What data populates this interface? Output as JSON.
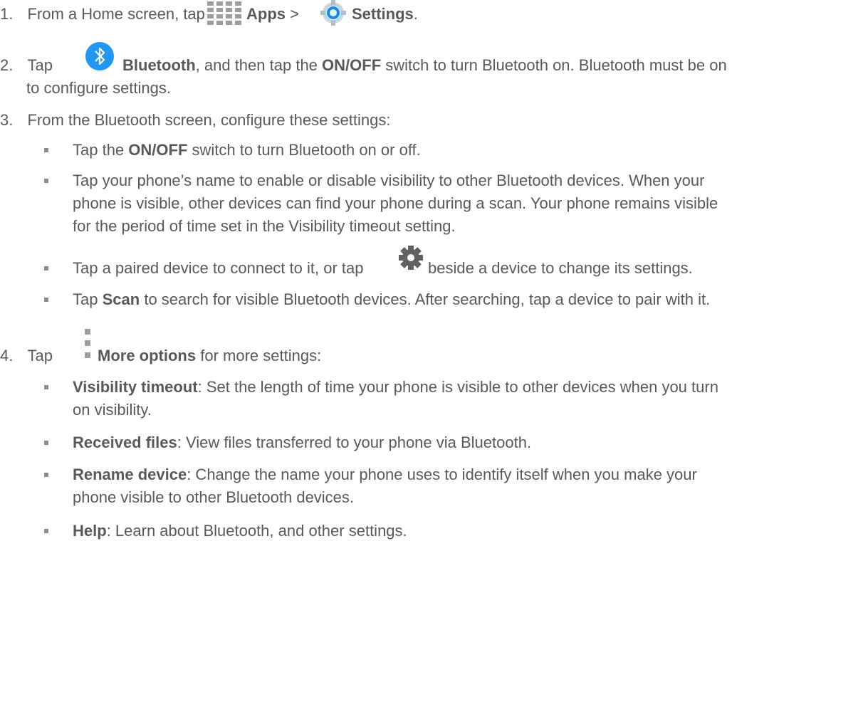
{
  "steps": [
    {
      "number": "1.",
      "parts": [
        "From a Home screen, tap",
        "Apps",
        ">",
        "Settings",
        "."
      ],
      "icons": [
        "apps-grid-icon",
        "settings-gear-icon"
      ]
    },
    {
      "number": "2.",
      "line1": [
        "Tap",
        "Bluetooth",
        ", and then tap the",
        "ON/OFF",
        "switch to turn Bluetooth on. Bluetooth must be on"
      ],
      "line2": "to configure settings.",
      "icons": [
        "bluetooth-icon"
      ]
    },
    {
      "number": "3.",
      "text": "From the Bluetooth screen, configure these settings:",
      "bullets": [
        {
          "lines": [
            [
              "Tap the",
              "ON/OFF",
              "switch to turn Bluetooth on or off."
            ]
          ]
        },
        {
          "lines": [
            "Tap your phone’s name to enable or disable visibility to other Bluetooth devices. When your",
            "phone is visible, other devices can find your phone during a scan. Your phone remains visible",
            "for the period of time set in the Visibility timeout setting."
          ]
        },
        {
          "lines": [
            [
              "Tap a paired device to connect to it, or tap",
              "beside a device to change its settings."
            ]
          ],
          "icons": [
            "gear-icon"
          ]
        },
        {
          "lines": [
            [
              "Tap",
              "Scan",
              "to search for visible Bluetooth devices. After searching, tap a device to pair with it."
            ]
          ]
        }
      ]
    },
    {
      "number": "4.",
      "parts": [
        "Tap",
        "More options",
        "for more settings:"
      ],
      "icons": [
        "more-options-icon"
      ],
      "bullets": [
        {
          "term": "Visibility timeout",
          "lines": [
            ": Set the length of time your phone is visible to other devices when you turn",
            "on visibility."
          ]
        },
        {
          "term": "Received files",
          "lines": [
            ": View files transferred to your phone via Bluetooth."
          ]
        },
        {
          "term": "Rename device",
          "lines": [
            ": Change the name your phone uses to identify itself when you make your",
            "phone visible to other Bluetooth devices."
          ]
        },
        {
          "term": "Help",
          "lines": [
            ": Learn about Bluetooth, and other settings."
          ]
        }
      ]
    }
  ],
  "colors": {
    "text": "#595959",
    "bluetooth_blue": "#2196f3",
    "settings_blue": "#1e88e5",
    "icon_gray": "#9e9e9e",
    "gear_dark": "#616161"
  }
}
